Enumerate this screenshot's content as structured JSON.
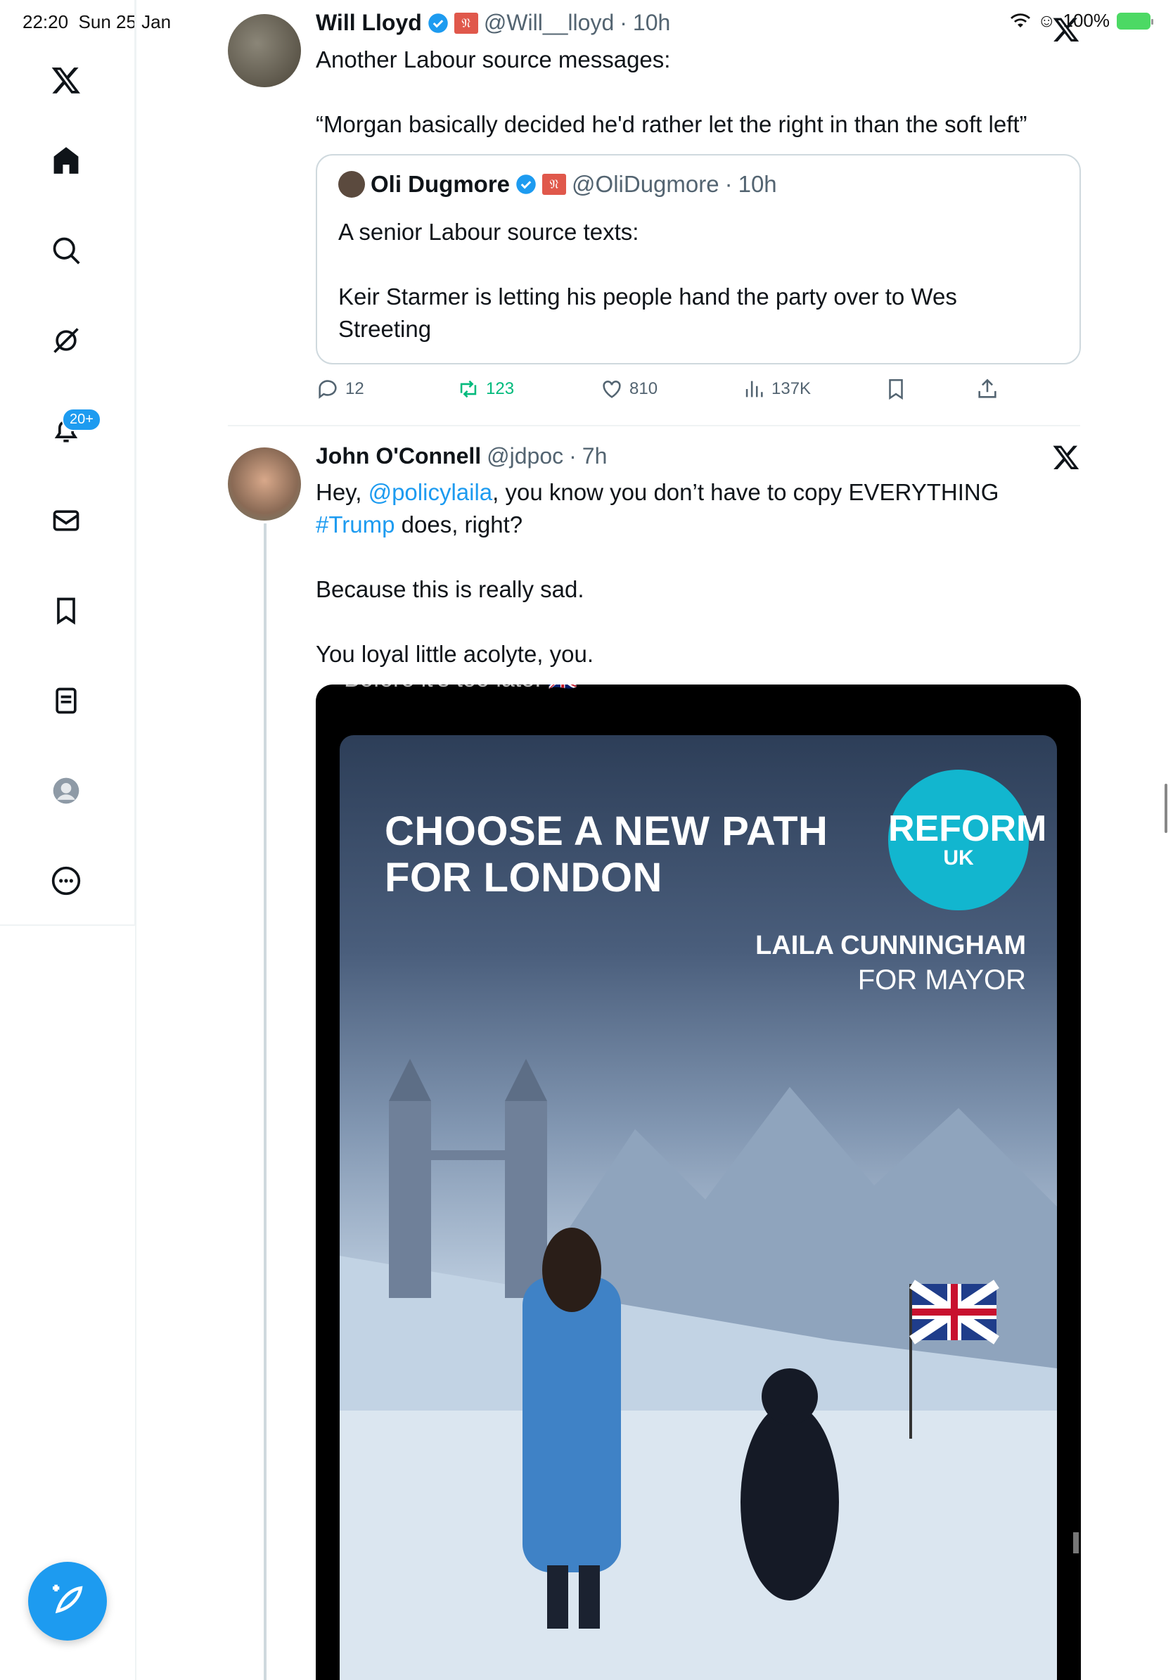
{
  "status_bar": {
    "time": "22:20",
    "date": "Sun 25 Jan",
    "battery": "100%"
  },
  "sidebar": {
    "notifications_badge": "20+",
    "items": [
      "x-logo-icon",
      "home-icon",
      "search-icon",
      "grok-icon",
      "notifications-icon",
      "messages-icon",
      "bookmarks-icon",
      "lists-icon",
      "profile-icon",
      "more-icon"
    ]
  },
  "tweets": [
    {
      "name": "Will Lloyd",
      "handle": "@Will__lloyd",
      "time": "10h",
      "text_lines": [
        "Another Labour source messages:",
        "“Morgan basically decided he'd rather let the right in than the soft left”"
      ],
      "quote": {
        "name": "Oli Dugmore",
        "handle": "@OliDugmore",
        "time": "10h",
        "text_lines": [
          "A senior Labour source texts:",
          "Keir Starmer is letting his people hand the party over to Wes Streeting"
        ]
      },
      "actions": {
        "replies": "12",
        "reposts": "123",
        "likes": "810",
        "views": "137K"
      }
    },
    {
      "name": "John O'Connell",
      "handle": "@jdpoc",
      "time": "7h",
      "text_hey": "Hey, ",
      "mention": "@policylaila",
      "text_after_mention": ", you know you don’t have to copy EVERYTHING",
      "hashtag": "#Trump",
      "text_after_hashtag": " does, right?",
      "line2": "Because this is really sad.",
      "line3": "You loyal little acolyte, you.",
      "media": {
        "top_clip_text": "Before it's too late. 🇬🇧",
        "headline_1": "CHOOSE A NEW PATH",
        "headline_2": "FOR LONDON",
        "logo_main": "REFORM",
        "logo_sub": "UK",
        "candidate": "LAILA CUNNINGHAM",
        "role": "FOR MAYOR"
      }
    }
  ],
  "colors": {
    "accent": "#1d9bf0",
    "repost_green": "#00ba7c",
    "secondary_text": "#536471",
    "border": "#cfd9de"
  }
}
